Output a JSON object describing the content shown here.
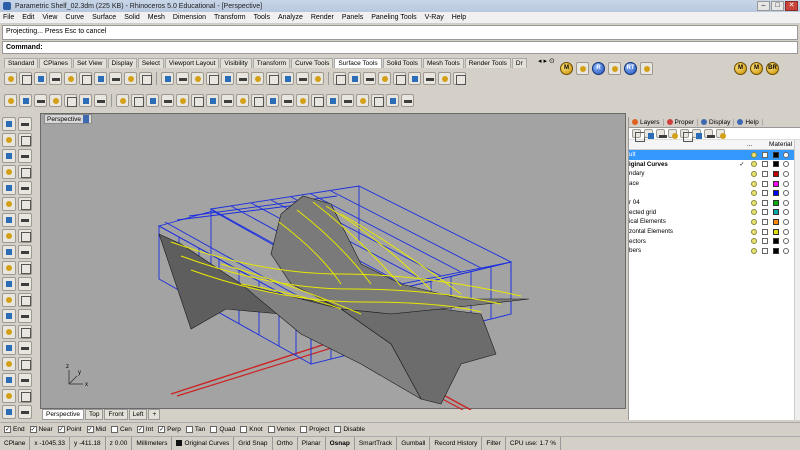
{
  "window": {
    "title": "Parametric Shelf_02.3dm (225 KB) - Rhinoceros 5.0 Educational - [Perspective]"
  },
  "menu": [
    "File",
    "Edit",
    "View",
    "Curve",
    "Surface",
    "Solid",
    "Mesh",
    "Dimension",
    "Transform",
    "Tools",
    "Analyze",
    "Render",
    "Panels",
    "Paneling Tools",
    "V-Ray",
    "Help"
  ],
  "history": {
    "text": "Projecting... Press Esc to cancel"
  },
  "command": {
    "label": "Command:",
    "value": ""
  },
  "toolbar_tabs": [
    "Standard",
    "CPlanes",
    "Set View",
    "Display",
    "Select",
    "Viewport Layout",
    "Visibility",
    "Transform",
    "Curve Tools",
    "Surface Tools",
    "Solid Tools",
    "Mesh Tools",
    "Render Tools",
    "Dr"
  ],
  "active_toolbar_tab": "Surface Tools",
  "right_tools": [
    "M",
    "R",
    "RT",
    "M",
    "M",
    "BR"
  ],
  "viewport": {
    "label": "Perspective",
    "axes": {
      "x": "x",
      "y": "y",
      "z": "z"
    }
  },
  "viewport_tabs": [
    "Perspective",
    "Top",
    "Front",
    "Left"
  ],
  "panel": {
    "tabs": [
      "Layers",
      "Proper",
      "Display",
      "Help"
    ],
    "header": {
      "col_more": "...",
      "col_material": "Material"
    },
    "layers": [
      {
        "name": "ult",
        "color": "#000000",
        "selected": true,
        "current": ""
      },
      {
        "name": "iginal Curves",
        "color": "#000000",
        "selected": false,
        "current": "✓"
      },
      {
        "name": "ndary",
        "color": "#c00000",
        "selected": false,
        "current": ""
      },
      {
        "name": "ace",
        "color": "#ff00ff",
        "selected": false,
        "current": ""
      },
      {
        "name": "",
        "color": "#0000ff",
        "selected": false,
        "current": ""
      },
      {
        "name": "r 04",
        "color": "#00b000",
        "selected": false,
        "current": ""
      },
      {
        "name": "ected grid",
        "color": "#00aaaa",
        "selected": false,
        "current": ""
      },
      {
        "name": "ical Elements",
        "color": "#ff8800",
        "selected": false,
        "current": ""
      },
      {
        "name": "zontal Elements",
        "color": "#dddd00",
        "selected": false,
        "current": ""
      },
      {
        "name": "ectors",
        "color": "#000000",
        "selected": false,
        "current": ""
      },
      {
        "name": "bers",
        "color": "#000000",
        "selected": false,
        "current": ""
      }
    ]
  },
  "osnap": [
    {
      "label": "End",
      "checked": true
    },
    {
      "label": "Near",
      "checked": true
    },
    {
      "label": "Point",
      "checked": true
    },
    {
      "label": "Mid",
      "checked": true
    },
    {
      "label": "Cen",
      "checked": false
    },
    {
      "label": "Int",
      "checked": true
    },
    {
      "label": "Perp",
      "checked": true
    },
    {
      "label": "Tan",
      "checked": false
    },
    {
      "label": "Quad",
      "checked": false
    },
    {
      "label": "Knot",
      "checked": false
    },
    {
      "label": "Vertex",
      "checked": false
    },
    {
      "label": "Project",
      "checked": false
    },
    {
      "label": "Disable",
      "checked": false
    }
  ],
  "status": {
    "cplane": "CPlane",
    "x": "x -1045.33",
    "y": "y -411.18",
    "z": "z 0.00",
    "units": "Millimeters",
    "layer": "Original Curves",
    "items": [
      "Grid Snap",
      "Ortho",
      "Planar",
      "Osnap",
      "SmartTrack",
      "Gumball",
      "Record History",
      "Filter"
    ],
    "bold_item": "Osnap",
    "cpu": "CPU use: 1.7 %"
  }
}
